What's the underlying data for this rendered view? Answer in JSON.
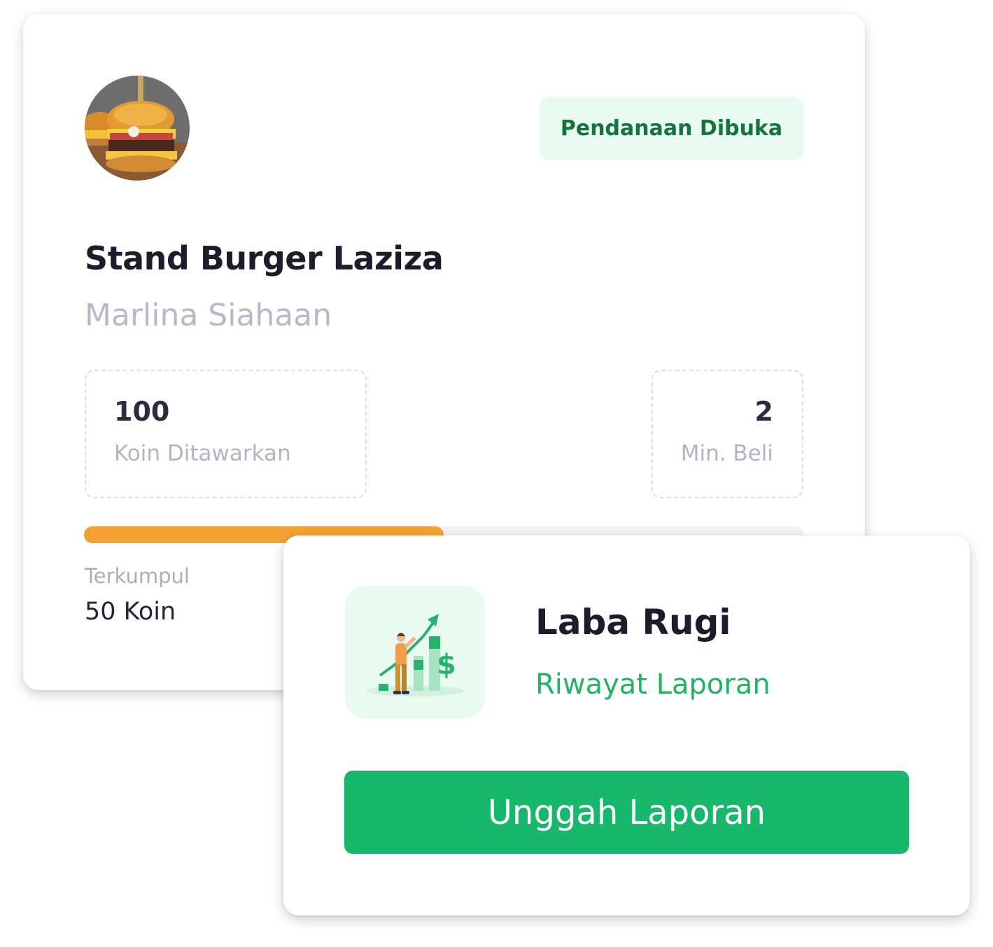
{
  "campaign": {
    "status_badge": "Pendanaan Dibuka",
    "title": "Stand Burger Laziza",
    "owner": "Marlina Siahaan",
    "offered": {
      "value": "100",
      "label": "Koin Ditawarkan"
    },
    "min_buy": {
      "value": "2",
      "label": "Min. Beli"
    },
    "progress_fraction": 0.5,
    "progress_color": "#f4a134",
    "collected": {
      "label": "Terkumpul",
      "value": "50 Koin"
    }
  },
  "report": {
    "title": "Laba Rugi",
    "link_label": "Riwayat Laporan",
    "upload_button": "Unggah Laporan",
    "illustration_icon": "profit-growth-chart-icon",
    "accent_color": "#17b86b"
  }
}
